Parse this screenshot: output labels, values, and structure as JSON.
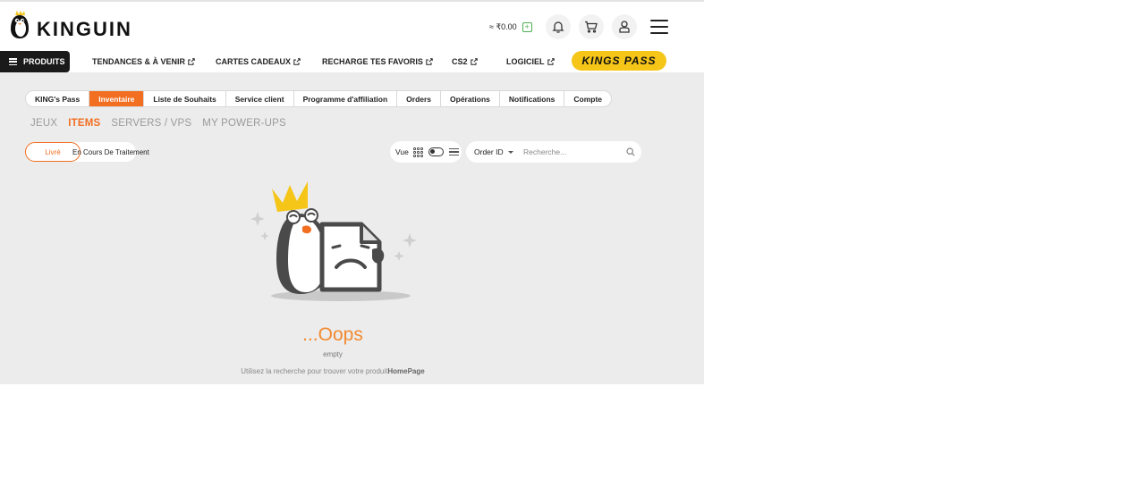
{
  "header": {
    "logo_text": "KINGUIN",
    "wallet": {
      "balance": "≈ ₹0.00",
      "add_symbol": "+"
    }
  },
  "nav": {
    "products": "PRODUITS",
    "items": [
      {
        "label": "TENDANCES & À VENIR"
      },
      {
        "label": "CARTES CADEAUX"
      },
      {
        "label": "RECHARGE TES FAVORIS"
      },
      {
        "label": "CS2"
      },
      {
        "label": "LOGICIEL"
      }
    ],
    "kings_pass": "KINGS PASS"
  },
  "tabs": [
    {
      "label": "KING's Pass",
      "active": false
    },
    {
      "label": "Inventaire",
      "active": true
    },
    {
      "label": "Liste de Souhaits",
      "active": false
    },
    {
      "label": "Service client",
      "active": false
    },
    {
      "label": "Programme d'affiliation",
      "active": false
    },
    {
      "label": "Orders",
      "active": false
    },
    {
      "label": "Opérations",
      "active": false
    },
    {
      "label": "Notifications",
      "active": false
    },
    {
      "label": "Compte",
      "active": false
    }
  ],
  "subtabs": [
    {
      "label": "JEUX",
      "active": false
    },
    {
      "label": "ITEMS",
      "active": true
    },
    {
      "label": "SERVERS / VPS",
      "active": false
    },
    {
      "label": "MY POWER-UPS",
      "active": false
    }
  ],
  "status": {
    "delivered": "Livré",
    "processing": "En Cours De Traitement"
  },
  "view": {
    "label": "Vue"
  },
  "search": {
    "order_select": "Order ID",
    "placeholder": "Recherche..."
  },
  "empty_state": {
    "title": "...Oops",
    "subtitle": "empty",
    "hint": "Utilisez la recherche pour trouver votre produit",
    "hint_link": "HomePage"
  },
  "colors": {
    "accent": "#f26e21",
    "kings_pass": "#f5c518",
    "content_bg": "#ececec"
  }
}
